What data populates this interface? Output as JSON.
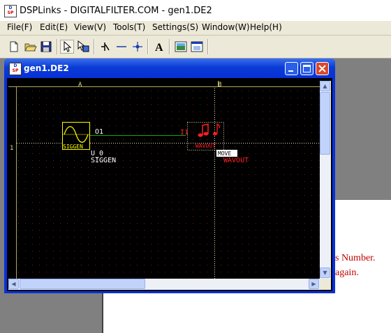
{
  "app": {
    "title": "DSPLinks - DIGITALFILTER.COM - gen1.DE2",
    "icon_top": "D",
    "icon_bottom": "SP"
  },
  "menu": [
    "File(F)",
    "Edit(E)",
    "View(V)",
    "Tools(T)",
    "Settings(S)",
    "Window(W)",
    "Help(H)"
  ],
  "toolbar": {
    "icons": [
      "new-file-icon",
      "open-folder-icon",
      "save-icon",
      "pointer-icon",
      "move-icon",
      "signal-icon",
      "wire-icon",
      "node-icon",
      "text-icon",
      "image-icon",
      "window-icon"
    ],
    "text_button_label": "A"
  },
  "child_window": {
    "title": "gen1.DE2",
    "icon_top": "D",
    "icon_bottom": "SP",
    "minimize_label": "_",
    "close_label": "×"
  },
  "schematic": {
    "column_labels": [
      "A",
      "B"
    ],
    "row_labels": [
      "1"
    ],
    "siggen": {
      "block_label": "SIGGEN",
      "port_label": "O1",
      "instance_name": "U_0",
      "type_name": "SIGGEN"
    },
    "wavout": {
      "block_label": "WAVOUT",
      "port_label": "I1",
      "move_badge": "MOVE",
      "type_name": "WAVOUT"
    }
  },
  "background_text": {
    "line1": "s Number.",
    "line2": "again."
  },
  "colors": {
    "canvas_bg": "#000000",
    "grid_dot": "#7a1a1a",
    "ruler_text": "#e6e07a",
    "siggen_outline": "#ffff00",
    "wire": "#00b000",
    "wavout_red": "#ff2020",
    "label_white": "#ffffff",
    "title_blue": "#0831d9"
  }
}
